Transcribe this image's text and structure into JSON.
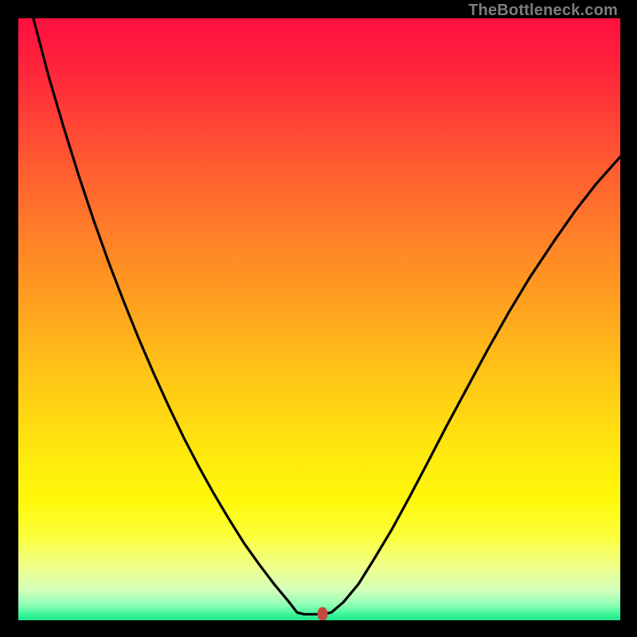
{
  "watermark": "TheBottleneck.com",
  "chart_data": {
    "type": "line",
    "title": "",
    "xlabel": "",
    "ylabel": "",
    "xlim": [
      0,
      1
    ],
    "ylim": [
      0,
      1
    ],
    "x": [
      0.0,
      0.025,
      0.05,
      0.075,
      0.1,
      0.125,
      0.15,
      0.175,
      0.2,
      0.225,
      0.25,
      0.275,
      0.3,
      0.325,
      0.35,
      0.375,
      0.4,
      0.425,
      0.45,
      0.463,
      0.475,
      0.49,
      0.505,
      0.52,
      0.54,
      0.565,
      0.59,
      0.62,
      0.65,
      0.68,
      0.71,
      0.745,
      0.78,
      0.815,
      0.85,
      0.89,
      0.925,
      0.96,
      1.0
    ],
    "values": [
      1.11,
      1.0,
      0.905,
      0.82,
      0.74,
      0.665,
      0.595,
      0.53,
      0.468,
      0.41,
      0.355,
      0.303,
      0.255,
      0.21,
      0.168,
      0.128,
      0.093,
      0.06,
      0.03,
      0.013,
      0.01,
      0.01,
      0.01,
      0.013,
      0.03,
      0.06,
      0.1,
      0.15,
      0.205,
      0.262,
      0.32,
      0.385,
      0.45,
      0.512,
      0.57,
      0.63,
      0.68,
      0.725,
      0.77
    ],
    "marker": {
      "x": 0.505,
      "y": 0.01
    },
    "gradient_stops": [
      {
        "offset": 0.0,
        "color": "#ff0e3f"
      },
      {
        "offset": 0.1,
        "color": "#ff2a3a"
      },
      {
        "offset": 0.22,
        "color": "#ff5332"
      },
      {
        "offset": 0.35,
        "color": "#ff7c29"
      },
      {
        "offset": 0.48,
        "color": "#ffa31f"
      },
      {
        "offset": 0.6,
        "color": "#ffc716"
      },
      {
        "offset": 0.72,
        "color": "#ffe80e"
      },
      {
        "offset": 0.8,
        "color": "#fff80a"
      },
      {
        "offset": 0.86,
        "color": "#fbff3a"
      },
      {
        "offset": 0.91,
        "color": "#f0ff8a"
      },
      {
        "offset": 0.95,
        "color": "#d4ffba"
      },
      {
        "offset": 0.975,
        "color": "#8dffb5"
      },
      {
        "offset": 0.99,
        "color": "#3cf59a"
      },
      {
        "offset": 1.0,
        "color": "#1fe58c"
      }
    ]
  }
}
